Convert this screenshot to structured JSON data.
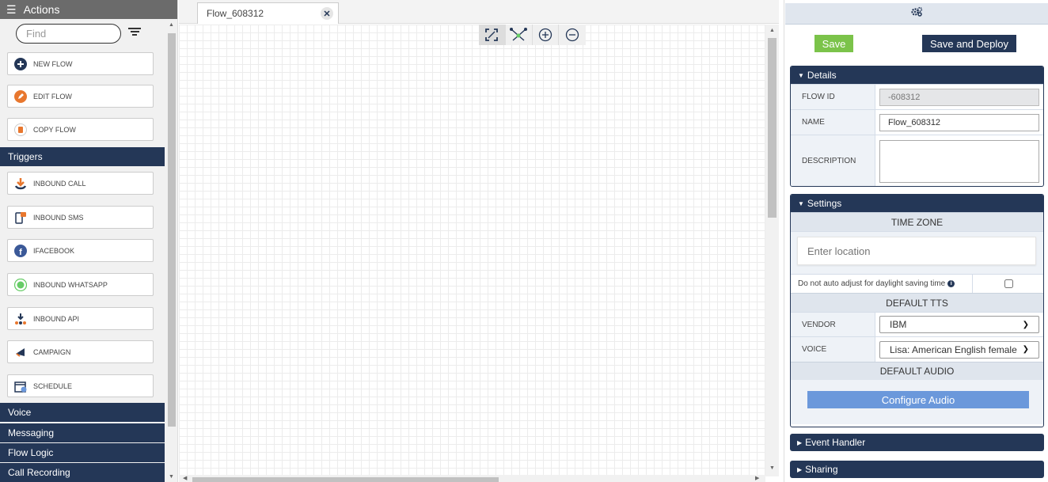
{
  "sidebar": {
    "title": "Actions",
    "search_placeholder": "Find",
    "actions": [
      {
        "label": "NEW FLOW",
        "icon": "plus-circle-icon"
      },
      {
        "label": "EDIT FLOW",
        "icon": "pencil-icon"
      },
      {
        "label": "COPY FLOW",
        "icon": "copy-icon"
      }
    ],
    "triggers_title": "Triggers",
    "triggers": [
      {
        "label": "INBOUND CALL",
        "icon": "inbound-call-icon"
      },
      {
        "label": "INBOUND SMS",
        "icon": "sms-icon"
      },
      {
        "label": "IFACEBOOK",
        "icon": "facebook-icon"
      },
      {
        "label": "INBOUND WHATSAPP",
        "icon": "whatsapp-icon"
      },
      {
        "label": "INBOUND API",
        "icon": "api-icon"
      },
      {
        "label": "CAMPAIGN",
        "icon": "megaphone-icon"
      },
      {
        "label": "SCHEDULE",
        "icon": "calendar-icon"
      }
    ],
    "categories": [
      "Voice",
      "Messaging",
      "Flow Logic",
      "Call Recording"
    ]
  },
  "canvas": {
    "tab_label": "Flow_608312"
  },
  "panel": {
    "save_label": "Save",
    "deploy_label": "Save and Deploy",
    "details": {
      "title": "Details",
      "flow_id_label": "FLOW ID",
      "flow_id_value": "-608312",
      "name_label": "NAME",
      "name_value": "Flow_608312",
      "description_label": "DESCRIPTION",
      "description_value": ""
    },
    "settings": {
      "title": "Settings",
      "timezone_header": "TIME ZONE",
      "location_placeholder": "Enter location",
      "dst_label": "Do not auto adjust for daylight saving time",
      "tts_header": "DEFAULT TTS",
      "vendor_label": "VENDOR",
      "vendor_value": "IBM",
      "voice_label": "VOICE",
      "voice_value": "Lisa: American English female",
      "audio_header": "DEFAULT AUDIO",
      "configure_audio_label": "Configure Audio"
    },
    "event_handler_title": "Event Handler",
    "sharing_title": "Sharing"
  },
  "colors": {
    "navy": "#243757",
    "save_green": "#7bc34a",
    "configure_blue": "#6b98db"
  }
}
